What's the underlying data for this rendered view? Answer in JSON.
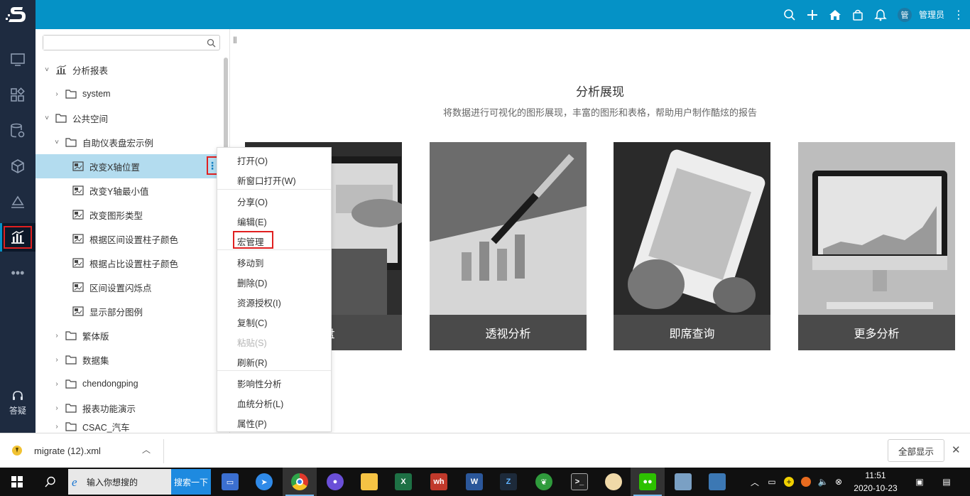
{
  "header": {
    "user_initial": "管",
    "username": "管理员"
  },
  "rail": {
    "help_label": "答疑"
  },
  "tree": {
    "search_placeholder": "",
    "nodes": [
      {
        "label": "分析报表",
        "arrow": "˅",
        "icon": "chart-icon"
      },
      {
        "label": "system",
        "arrow": "›",
        "icon": "folder-icon"
      },
      {
        "label": "公共空间",
        "arrow": "˅",
        "icon": "folder-icon"
      },
      {
        "label": "自助仪表盘宏示例",
        "arrow": "˅",
        "icon": "folder-icon"
      },
      {
        "label": "改变X轴位置",
        "arrow": "",
        "icon": "report-icon"
      },
      {
        "label": "改变Y轴最小值",
        "arrow": "",
        "icon": "report-icon"
      },
      {
        "label": "改变图形类型",
        "arrow": "",
        "icon": "report-icon"
      },
      {
        "label": "根据区间设置柱子颜色",
        "arrow": "",
        "icon": "report-icon"
      },
      {
        "label": "根据占比设置柱子颜色",
        "arrow": "",
        "icon": "report-icon"
      },
      {
        "label": "区间设置闪烁点",
        "arrow": "",
        "icon": "report-icon"
      },
      {
        "label": "显示部分图例",
        "arrow": "",
        "icon": "report-icon"
      },
      {
        "label": "繁体版",
        "arrow": "›",
        "icon": "folder-icon"
      },
      {
        "label": "数据集",
        "arrow": "›",
        "icon": "folder-icon"
      },
      {
        "label": "chendongping",
        "arrow": "›",
        "icon": "folder-icon"
      },
      {
        "label": "报表功能演示",
        "arrow": "›",
        "icon": "folder-icon"
      },
      {
        "label": "CSAC_汽车",
        "arrow": "›",
        "icon": "folder-icon"
      }
    ]
  },
  "context_menu": {
    "items": [
      {
        "label": "打开(O)",
        "disabled": false
      },
      {
        "label": "新窗口打开(W)",
        "disabled": false
      },
      {
        "label": "分享(O)",
        "disabled": false
      },
      {
        "label": "编辑(E)",
        "disabled": false
      },
      {
        "label": "宏管理",
        "disabled": false
      },
      {
        "label": "移动到",
        "disabled": false
      },
      {
        "label": "删除(D)",
        "disabled": false
      },
      {
        "label": "资源授权(I)",
        "disabled": false
      },
      {
        "label": "复制(C)",
        "disabled": false
      },
      {
        "label": "粘贴(S)",
        "disabled": true
      },
      {
        "label": "刷新(R)",
        "disabled": false
      },
      {
        "label": "影响性分析",
        "disabled": false
      },
      {
        "label": "血统分析(L)",
        "disabled": false
      },
      {
        "label": "属性(P)",
        "disabled": false
      }
    ]
  },
  "main": {
    "title": "分析展现",
    "subtitle": "将数据进行可视化的图形展现，丰富的图形和表格，帮助用户制作酷炫的报告",
    "cards": [
      {
        "label": "表盘"
      },
      {
        "label": "透视分析"
      },
      {
        "label": "即席查询"
      },
      {
        "label": "更多分析"
      }
    ]
  },
  "download_bar": {
    "filename": "migrate (12).xml",
    "show_all": "全部显示"
  },
  "taskbar": {
    "search_placeholder": "输入你想搜的",
    "search_button": "搜索一下",
    "time": "11:51",
    "date": "2020-10-23"
  },
  "colors": {
    "header": "#0592c6",
    "rail": "#1e2b40",
    "selected_row": "#b3dcef",
    "highlight": "#e02020"
  }
}
